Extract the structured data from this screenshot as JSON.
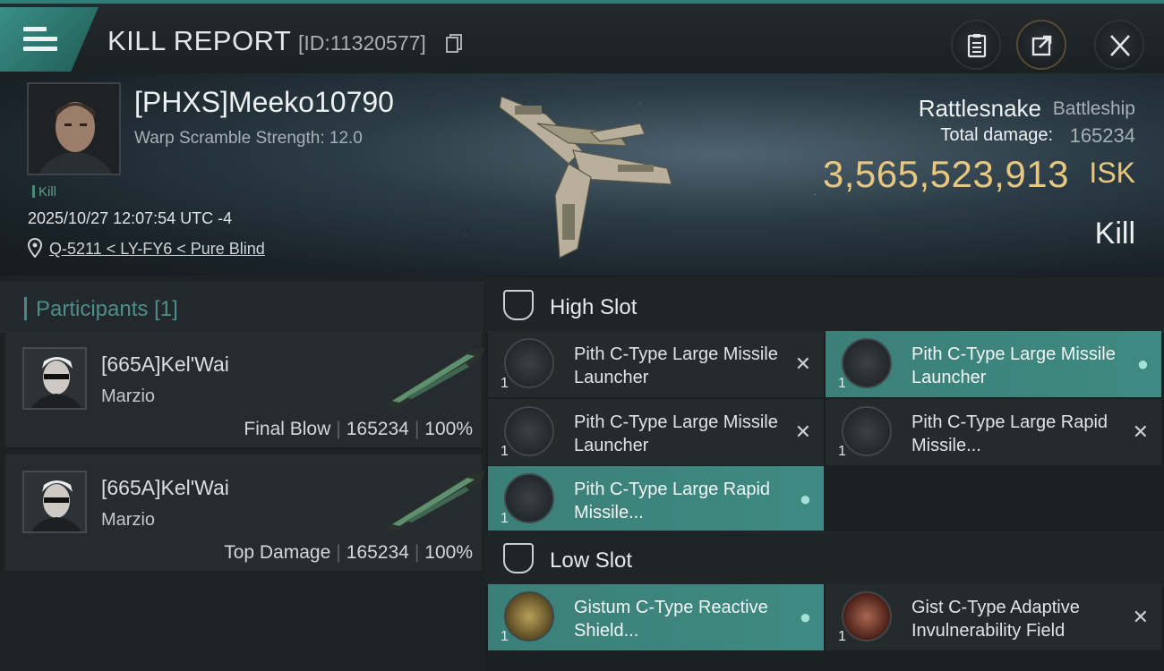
{
  "header": {
    "title": "KILL REPORT",
    "report_id": "[ID:11320577]",
    "menu_icon": "hamburger-icon",
    "actions": [
      {
        "icon": "clipboard-icon"
      },
      {
        "icon": "share-icon"
      },
      {
        "icon": "close-icon"
      }
    ]
  },
  "victim": {
    "name": "[PHXS]Meeko10790",
    "warp_scramble": "Warp Scramble Strength: 12.0",
    "tag": "Kill",
    "datetime": "2025/10/27 12:07:54 UTC -4",
    "location": "Q-5211 < LY-FY6 < Pure Blind",
    "ship_name": "Rattlesnake",
    "ship_class": "Battleship",
    "total_damage_label": "Total damage:",
    "total_damage": "165234",
    "isk_value": "3,565,523,913",
    "isk_unit": "ISK",
    "result": "Kill"
  },
  "participants": {
    "title": "Participants",
    "count": "[1]",
    "items": [
      {
        "name": "[665A]Kel'Wai",
        "corp": "Marzio",
        "role": "Final Blow",
        "damage": "165234",
        "percent": "100%"
      },
      {
        "name": "[665A]Kel'Wai",
        "corp": "Marzio",
        "role": "Top Damage",
        "damage": "165234",
        "percent": "100%"
      }
    ]
  },
  "fitting": {
    "high_slot_title": "High Slot",
    "low_slot_title": "Low Slot",
    "high": [
      {
        "qty": "1",
        "name": "Pith C-Type Large Missile Launcher",
        "status": "destroyed",
        "highlight": false
      },
      {
        "qty": "1",
        "name": "Pith C-Type Large Missile Launcher",
        "status": "dropped",
        "highlight": true
      },
      {
        "qty": "1",
        "name": "Pith C-Type Large Missile Launcher",
        "status": "destroyed",
        "highlight": false
      },
      {
        "qty": "1",
        "name": "Pith C-Type Large Rapid Missile...",
        "status": "destroyed",
        "highlight": false
      },
      {
        "qty": "1",
        "name": "Pith C-Type Large Rapid Missile...",
        "status": "dropped",
        "highlight": true
      }
    ],
    "low": [
      {
        "qty": "1",
        "name": "Gistum C-Type Reactive Shield...",
        "status": "dropped",
        "highlight": true
      },
      {
        "qty": "1",
        "name": "Gist C-Type Adaptive Invulnerability Field",
        "status": "destroyed",
        "highlight": false
      }
    ]
  },
  "colors": {
    "accent": "#3e8a82",
    "isk": "#e9c77f",
    "panel": "#252a2d"
  }
}
